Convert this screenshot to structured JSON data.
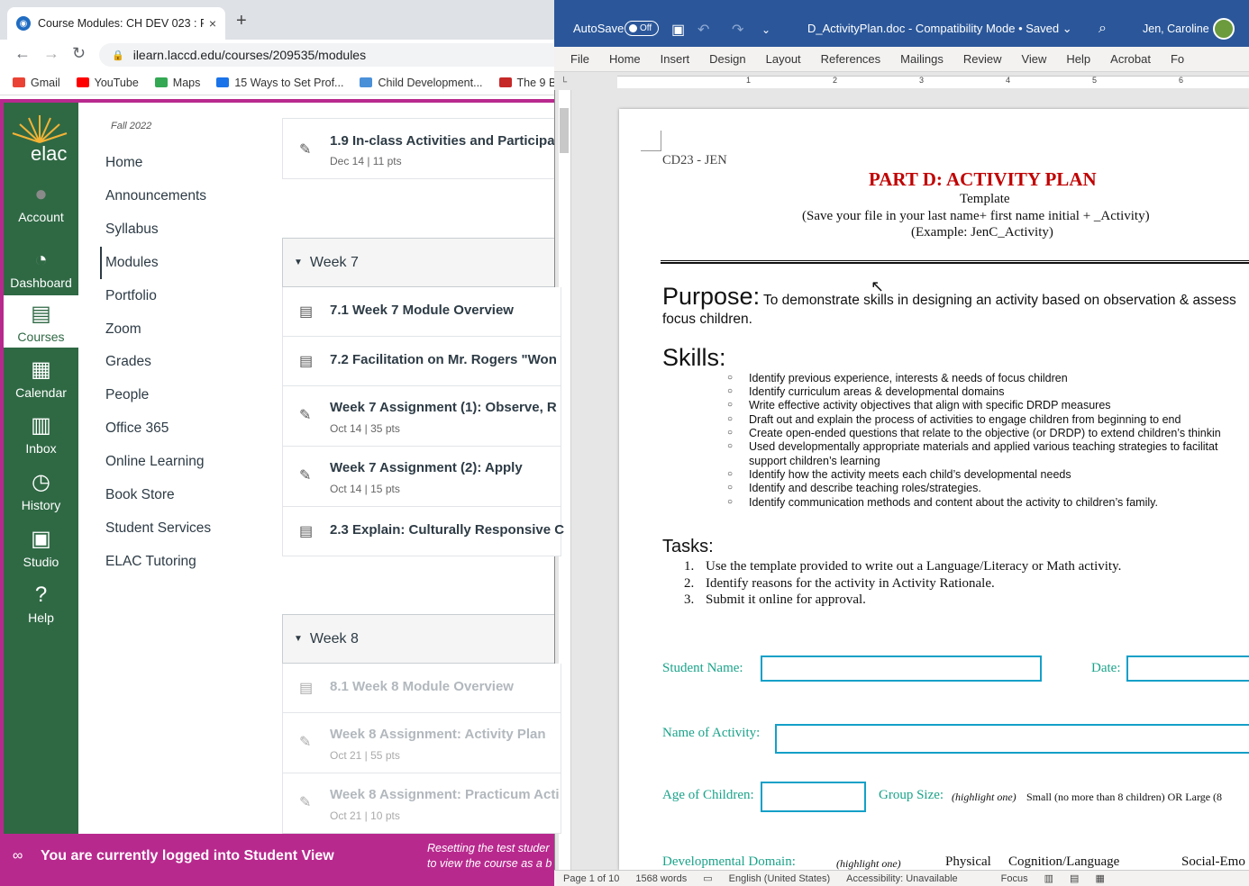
{
  "browser": {
    "tab_title": "Course Modules: CH DEV 023 : P",
    "tab_close": "×",
    "new_tab": "+",
    "url": "ilearn.laccd.edu/courses/209535/modules",
    "bookmarks": [
      {
        "label": "Gmail",
        "color": "#ea4335"
      },
      {
        "label": "YouTube",
        "color": "#ff0000"
      },
      {
        "label": "Maps",
        "color": "#34a853"
      },
      {
        "label": "15 Ways to Set Prof...",
        "color": "#1a73e8"
      },
      {
        "label": "Child Development...",
        "color": "#4a90d9"
      },
      {
        "label": "The 9 Be",
        "color": "#c62828"
      }
    ]
  },
  "canvas": {
    "logo": "elac",
    "global_nav": [
      {
        "label": "Account",
        "icon": "avatar-icon"
      },
      {
        "label": "Dashboard",
        "icon": "dashboard-icon"
      },
      {
        "label": "Courses",
        "icon": "courses-icon"
      },
      {
        "label": "Calendar",
        "icon": "calendar-icon"
      },
      {
        "label": "Inbox",
        "icon": "inbox-icon"
      },
      {
        "label": "History",
        "icon": "history-icon"
      },
      {
        "label": "Studio",
        "icon": "studio-icon"
      },
      {
        "label": "Help",
        "icon": "help-icon"
      }
    ],
    "term": "Fall 2022",
    "course_nav": [
      "Home",
      "Announcements",
      "Syllabus",
      "Modules",
      "Portfolio",
      "Zoom",
      "Grades",
      "People",
      "Office 365",
      "Online Learning",
      "Book Store",
      "Student Services",
      "ELAC Tutoring"
    ],
    "modules": {
      "top_item": {
        "title": "1.9 In-class Activities and Participat",
        "meta": "Dec 14  |  11 pts"
      },
      "week7": {
        "title": "Week 7",
        "items": [
          {
            "title": "7.1 Week 7 Module Overview",
            "meta": ""
          },
          {
            "title": "7.2 Facilitation on Mr. Rogers \"Won",
            "meta": ""
          },
          {
            "title": "Week 7 Assignment (1): Observe, R",
            "meta": "Oct 14  |  35 pts"
          },
          {
            "title": "Week 7 Assignment (2): Apply",
            "meta": "Oct 14  |  15 pts"
          },
          {
            "title": "2.3 Explain: Culturally Responsive C",
            "meta": ""
          }
        ]
      },
      "week8": {
        "title": "Week 8",
        "items": [
          {
            "title": "8.1 Week 8 Module Overview",
            "meta": ""
          },
          {
            "title": "Week 8 Assignment: Activity Plan",
            "meta": "Oct 21  |  55 pts"
          },
          {
            "title": "Week 8 Assignment: Practicum Acti",
            "meta": "Oct 21  |  10 pts"
          }
        ]
      }
    },
    "student_view": {
      "message": "You are currently logged into Student View",
      "reset_line1": "Resetting the test studer",
      "reset_line2": "to view the course as a b"
    }
  },
  "word": {
    "autosave_label": "AutoSave",
    "autosave_state": "Off",
    "doc_title": "D_ActivityPlan.doc  -  Compatibility Mode • Saved",
    "user": "Jen, Caroline",
    "ribbon_tabs": [
      "File",
      "Home",
      "Insert",
      "Design",
      "Layout",
      "References",
      "Mailings",
      "Review",
      "View",
      "Help",
      "Acrobat",
      "Fo"
    ],
    "ruler_numbers": [
      "1",
      "2",
      "3",
      "4",
      "5",
      "6"
    ],
    "document": {
      "header_code": "CD23 - JEN",
      "title": "PART D: ACTIVITY PLAN",
      "subtitle": "Template",
      "save_note": "(Save your file in your last name+ first name initial + _Activity)",
      "example": "(Example: JenC_Activity)",
      "purpose_heading": "Purpose:",
      "purpose_text": "To demonstrate skills in designing an activity based on observation & assess",
      "purpose_text2": "focus children.",
      "skills_heading": "Skills:",
      "skills": [
        "Identify previous experience, interests & needs of focus children",
        "Identify curriculum areas & developmental domains",
        "Write effective activity objectives that align with specific DRDP measures",
        "Draft out and explain the process of activities to engage children from beginning to end",
        "Create open-ended questions that relate to the objective (or DRDP) to extend children’s thinkin",
        "Used developmentally appropriate materials and applied various teaching strategies to facilitat",
        "support children’s learning",
        "Identify how the activity meets each child’s developmental needs",
        "Identify and describe teaching roles/strategies.",
        "Identify communication methods and content about the activity to children’s family."
      ],
      "tasks_heading": "Tasks:",
      "tasks": [
        "Use the template provided to write out a Language/Literacy or Math activity.",
        "Identify reasons for the activity in Activity Rationale.",
        "Submit it online for approval."
      ],
      "task_numbers": [
        "1.",
        "2.",
        "3."
      ],
      "student_name_label": "Student Name:",
      "date_label": "Date:",
      "activity_name_label": "Name of Activity:",
      "age_label": "Age of Children:",
      "group_size_label": "Group Size:",
      "group_size_hint": "(highlight one)",
      "group_size_options": "Small (no more than 8 children)  OR  Large (8",
      "domain_label": "Developmental Domain:",
      "domain_hint": "(highlight one)",
      "domains": [
        "Physical",
        "Cognition/Language",
        "Social-Emo"
      ]
    },
    "status": {
      "page": "Page 1 of 10",
      "words": "1568 words",
      "language": "English (United States)",
      "accessibility": "Accessibility: Unavailable",
      "focus": "Focus"
    }
  }
}
